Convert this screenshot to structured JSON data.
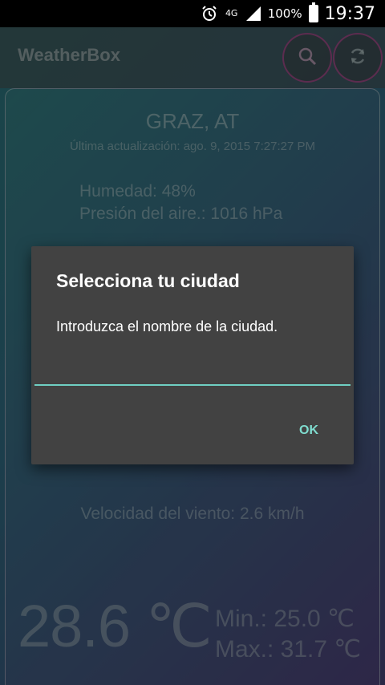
{
  "status_bar": {
    "network_type": "4G",
    "battery_percent": "100%",
    "time": "19:37",
    "icons": [
      "alarm-icon",
      "signal-icon",
      "battery-icon"
    ]
  },
  "action_bar": {
    "title": "WeatherBox",
    "actions": [
      "search-icon",
      "refresh-icon"
    ]
  },
  "weather": {
    "city": "GRAZ, AT",
    "last_updated": "Última actualización: ago. 9, 2015 7:27:27 PM",
    "humidity": "Humedad: 48%",
    "pressure": "Presión del aire.: 1016 hPa",
    "wind": "Velocidad del viento: 2.6 km/h",
    "temperature": "28.6 ℃",
    "min": "Min.: 25.0 ℃",
    "max": "Max.: 31.7 ℃"
  },
  "dialog": {
    "title": "Selecciona tu ciudad",
    "message": "Introduzca el nombre de la ciudad.",
    "input_value": "",
    "ok_label": "OK"
  },
  "colors": {
    "accent": "#7fdccf",
    "dialog_bg": "#424242",
    "action_ring": "#b4509a"
  }
}
